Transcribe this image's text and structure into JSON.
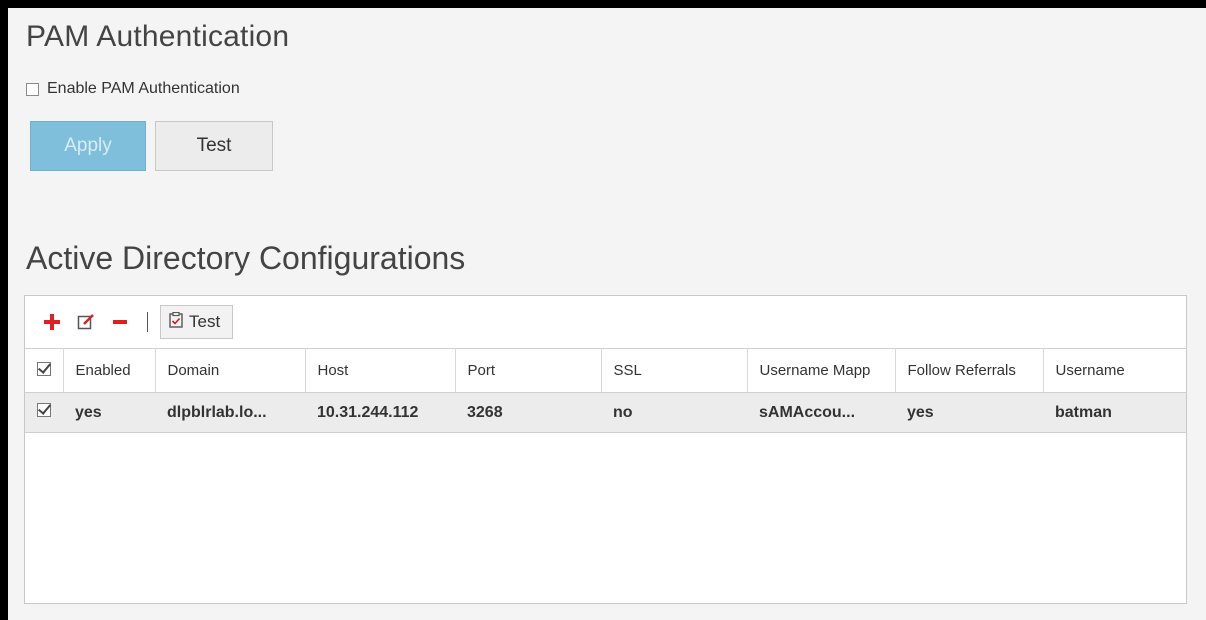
{
  "pam": {
    "title": "PAM Authentication",
    "enable_label": "Enable PAM Authentication",
    "enable_checked": false,
    "apply_label": "Apply",
    "test_label": "Test"
  },
  "ad": {
    "title": "Active Directory Configurations",
    "toolbar": {
      "add_icon": "plus-icon",
      "edit_icon": "edit-icon",
      "remove_icon": "minus-icon",
      "test_label": "Test",
      "test_icon": "clipboard-check-icon"
    },
    "columns": [
      "Enabled",
      "Domain",
      "Host",
      "Port",
      "SSL",
      "Username Mapp",
      "Follow Referrals",
      "Username"
    ],
    "rows": [
      {
        "checked": true,
        "enabled": "yes",
        "domain": "dlpblrlab.lo...",
        "host": "10.31.244.112",
        "port": "3268",
        "ssl": "no",
        "username_mapping": "sAMAccou...",
        "follow_referrals": "yes",
        "username": "batman"
      }
    ]
  },
  "colors": {
    "apply_bg": "#7fbfdc",
    "toolbar_red": "#e02020",
    "selected_row": "#ececec"
  }
}
